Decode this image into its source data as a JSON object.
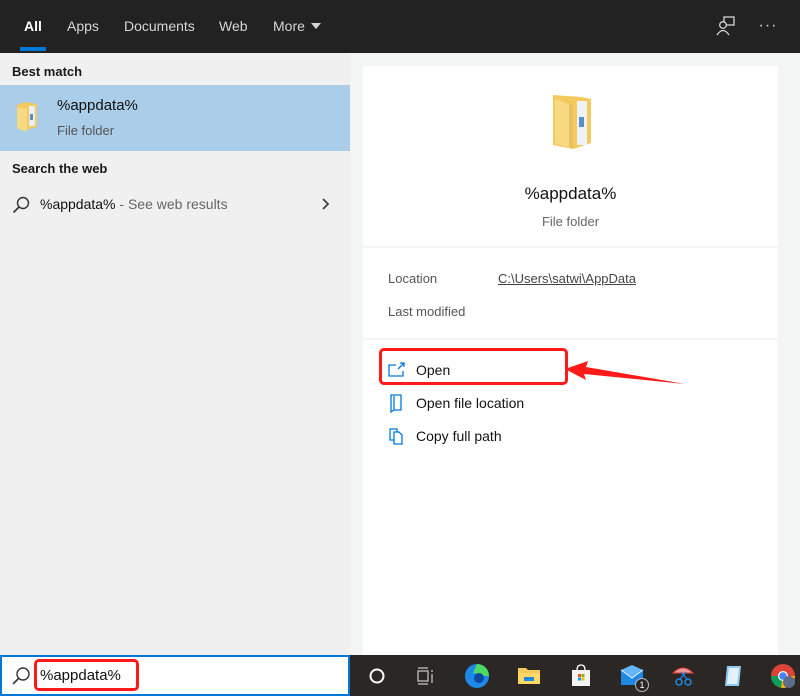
{
  "tabs": [
    {
      "label": "All",
      "active": true
    },
    {
      "label": "Apps",
      "active": false
    },
    {
      "label": "Documents",
      "active": false
    },
    {
      "label": "Web",
      "active": false
    },
    {
      "label": "More",
      "active": false
    }
  ],
  "header_icons": [
    "feedback-icon",
    "more-options-icon"
  ],
  "more_options_glyph": "···",
  "left_panel": {
    "best_match_label": "Best match",
    "best_match": {
      "title": "%appdata%",
      "subtitle": "File folder",
      "icon": "folder-icon"
    },
    "search_web_label": "Search the web",
    "web_result": {
      "query": "%appdata%",
      "hint": " - See web results",
      "icon": "search-icon"
    }
  },
  "preview": {
    "name": "%appdata%",
    "type": "File folder",
    "info": [
      {
        "key": "Location",
        "value": "C:\\Users\\satwi\\AppData"
      },
      {
        "key": "Last modified",
        "value": ""
      }
    ],
    "actions": [
      {
        "label": "Open",
        "icon": "open-icon"
      },
      {
        "label": "Open file location",
        "icon": "file-location-icon"
      },
      {
        "label": "Copy full path",
        "icon": "copy-icon"
      }
    ]
  },
  "search_box": {
    "value": "%appdata%"
  },
  "taskbar": {
    "items": [
      "cortana",
      "task-view",
      "edge",
      "file-explorer",
      "store",
      "mail",
      "snipping-tool",
      "notepad",
      "chrome"
    ],
    "mail_badge": "1"
  },
  "colors": {
    "accent": "#0078d7",
    "selection": "#aacdea",
    "annotation": "#ff1a1a"
  }
}
